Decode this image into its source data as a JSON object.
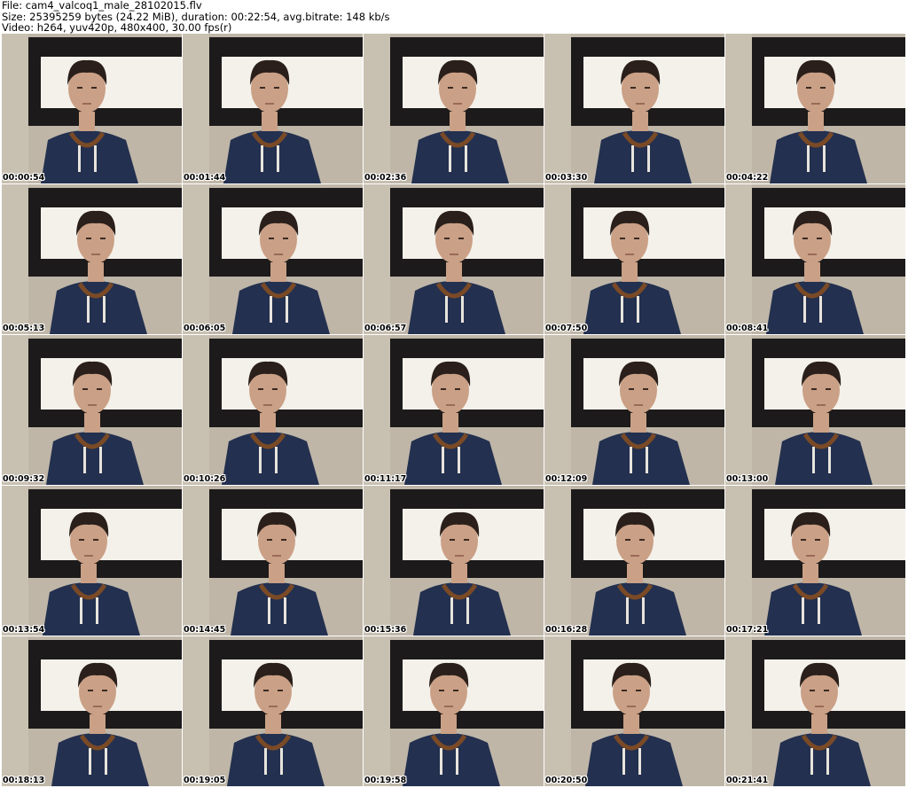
{
  "header": {
    "file_line": "File: cam4_valcoq1_male_28102015.flv",
    "size_line": "Size: 25395259 bytes (24.22 MiB), duration: 00:22:54, avg.bitrate: 148 kb/s",
    "video_line": "Video: h264, yuv420p, 480x400, 30.00 fps(r)"
  },
  "colors": {
    "wall": "#bfb6a8",
    "frame": "#1c1a1a",
    "window": "#f4f1ea",
    "skin": "#caa086",
    "hair": "#2a1f1a",
    "hoodie": "#23304f",
    "cord": "#7a4a26"
  },
  "frames": [
    {
      "time": "00:00:54"
    },
    {
      "time": "00:01:44"
    },
    {
      "time": "00:02:36"
    },
    {
      "time": "00:03:30"
    },
    {
      "time": "00:04:22"
    },
    {
      "time": "00:05:13"
    },
    {
      "time": "00:06:05"
    },
    {
      "time": "00:06:57"
    },
    {
      "time": "00:07:50"
    },
    {
      "time": "00:08:41"
    },
    {
      "time": "00:09:32"
    },
    {
      "time": "00:10:26"
    },
    {
      "time": "00:11:17"
    },
    {
      "time": "00:12:09"
    },
    {
      "time": "00:13:00"
    },
    {
      "time": "00:13:54"
    },
    {
      "time": "00:14:45"
    },
    {
      "time": "00:15:36"
    },
    {
      "time": "00:16:28"
    },
    {
      "time": "00:17:21"
    },
    {
      "time": "00:18:13"
    },
    {
      "time": "00:19:05"
    },
    {
      "time": "00:19:58"
    },
    {
      "time": "00:20:50"
    },
    {
      "time": "00:21:41"
    }
  ]
}
